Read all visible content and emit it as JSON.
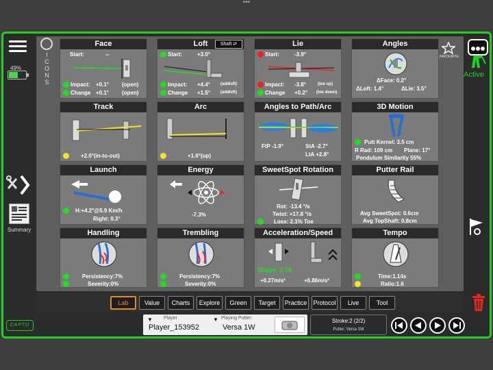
{
  "left": {
    "battery": "49%",
    "battery_level": 0.49,
    "summary_label": "Summary",
    "logo": "CAPTO"
  },
  "main": {
    "icons_toggle": "ICONS",
    "tiles": {
      "face": {
        "title": "Face",
        "start_label": "Start:",
        "start_value": "--",
        "impact_label": "Impact:",
        "impact_value": "+0.1°",
        "impact_note": "(open)",
        "change_label": "Change",
        "change_value": "+0.1°",
        "change_note": "(open)"
      },
      "loft": {
        "title": "Loft",
        "shaft_button": "Shaft ⇄",
        "start_label": "Start:",
        "start_value": "+3.0°",
        "impact_label": "Impact:",
        "impact_value": "+4.4°",
        "impact_note": "(addloft)",
        "change_label": "Change",
        "change_value": "+1.5°",
        "change_note": "(addloft)"
      },
      "lie": {
        "title": "Lie",
        "start_label": "Start:",
        "start_value": "-3.9°",
        "impact_label": "Impact:",
        "impact_value": "-3.8°",
        "impact_note": "(toe up)",
        "change_label": "Change",
        "change_value": "+0.2°",
        "change_note": "(toe down)"
      },
      "angles": {
        "title": "Angles",
        "favourite": "FAVOURITE",
        "dface": "ΔFace: 0.2°",
        "dloft": "ΔLoft: 1.4°",
        "dlie": "ΔLie: 3.5°"
      },
      "track": {
        "title": "Track",
        "value": "+2.0°(in-to-out)"
      },
      "arc": {
        "title": "Arc",
        "value": "+1.6°(up)"
      },
      "angles_path": {
        "title": "Angles to Path/Arc",
        "ftp": "FtP -1.9°",
        "sta": "StA -2.7°",
        "lta": "LtA +2.8°"
      },
      "motion": {
        "title": "3D Motion",
        "kernel": "Putt Kernel: 3.5 cm",
        "rrad": "R Rad: 109 cm",
        "plane": "Plane: 17°",
        "similarity": "Pendulum Similarity 55%"
      },
      "launch": {
        "title": "Launch",
        "h": "H:+4.2°@5.9 Km/h",
        "right": "Right: 0.3°"
      },
      "energy": {
        "title": "Energy",
        "value": "-7.3%"
      },
      "sweetspot": {
        "title": "SweetSpot Rotation",
        "rot": "Rot: -13.4 °/s",
        "twist": "Twist: +17.8 °/s",
        "loss": "Loss: 2.1% Toe"
      },
      "rail": {
        "title": "Putter Rail",
        "avg_sweet": "Avg SweetSpot: 0.6cm",
        "avg_top": "Avg TopShaft: 0.8cm"
      },
      "handling": {
        "title": "Handling",
        "persistency": "Persistency:7%",
        "severity": "Severity:0%"
      },
      "trembling": {
        "title": "Trembling",
        "persistency": "Persistency:7%",
        "severity": "Severity:0%"
      },
      "accel": {
        "title": "Acceleration/Speed",
        "shape": "Shape: 0.78",
        "v1": "+0.27m/s²",
        "v2": "+0.86m/s²"
      },
      "tempo": {
        "title": "Tempo",
        "time": "Time:1.14s",
        "ratio": "Ratio:1.6"
      }
    }
  },
  "tabs": [
    "Lab",
    "Value",
    "Charts",
    "Explore",
    "Green",
    "Target",
    "Practice",
    "Protocol",
    "Live",
    "Tool"
  ],
  "active_tab": "Lab",
  "footer": {
    "player_label": "Player",
    "player_value": "Player_153952",
    "putter_label": "Playing Putter:",
    "putter_value": "Versa 1W",
    "stroke": "Stroke:2 (2/2)",
    "stroke_putter": "Putter: Versa 1W"
  },
  "right": {
    "active_label": "Active"
  },
  "colors": {
    "accent": "#22d022",
    "active_tab": "#e88a20",
    "dot_green": "#22dd22",
    "dot_red": "#ee2222",
    "dot_yellow": "#f2e22a"
  }
}
